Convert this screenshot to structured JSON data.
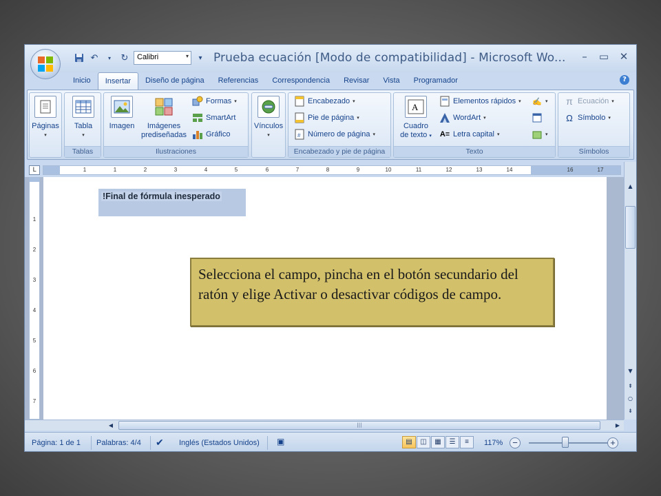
{
  "window": {
    "title": "Prueba ecuación [Modo de compatibilidad] - Microsoft Wo...",
    "font_name": "Calibri"
  },
  "tabs": [
    "Inicio",
    "Insertar",
    "Diseño de página",
    "Referencias",
    "Correspondencia",
    "Revisar",
    "Vista",
    "Programador"
  ],
  "active_tab": "Insertar",
  "ribbon": {
    "paginas": {
      "button": "Páginas"
    },
    "tablas": {
      "label": "Tablas",
      "tabla": "Tabla"
    },
    "ilustraciones": {
      "label": "Ilustraciones",
      "imagen": "Imagen",
      "imagenes_1": "Imágenes",
      "imagenes_2": "prediseñadas",
      "formas": "Formas",
      "smartart": "SmartArt",
      "grafico": "Gráfico"
    },
    "vinculos": {
      "button": "Vínculos"
    },
    "encabezado_pie": {
      "label": "Encabezado y pie de página",
      "encabezado": "Encabezado",
      "pie": "Pie de página",
      "numero": "Número de página"
    },
    "texto": {
      "label": "Texto",
      "cuadro_1": "Cuadro",
      "cuadro_2": "de texto",
      "elementos": "Elementos rápidos",
      "wordart": "WordArt",
      "letra_capital": "Letra capital"
    },
    "simbolos": {
      "label": "Símbolos",
      "ecuacion": "Ecuación",
      "simbolo": "Símbolo"
    }
  },
  "ruler": {
    "ticks": [
      "1",
      "1",
      "2",
      "3",
      "4",
      "5",
      "6",
      "7",
      "8",
      "9",
      "10",
      "11",
      "12",
      "13",
      "14",
      "16",
      "17"
    ],
    "vticks": [
      "1",
      "2",
      "3",
      "4",
      "5",
      "6",
      "7"
    ]
  },
  "document": {
    "field_text": "!Final de fórmula inesperado"
  },
  "statusbar": {
    "pagina": "Página: 1 de 1",
    "palabras": "Palabras: 4/4",
    "idioma": "Inglés (Estados Unidos)",
    "zoom": "117%"
  },
  "callout": {
    "text": "Selecciona el campo, pincha en el botón secundario del ratón y elige Activar o desactivar códigos de campo."
  }
}
